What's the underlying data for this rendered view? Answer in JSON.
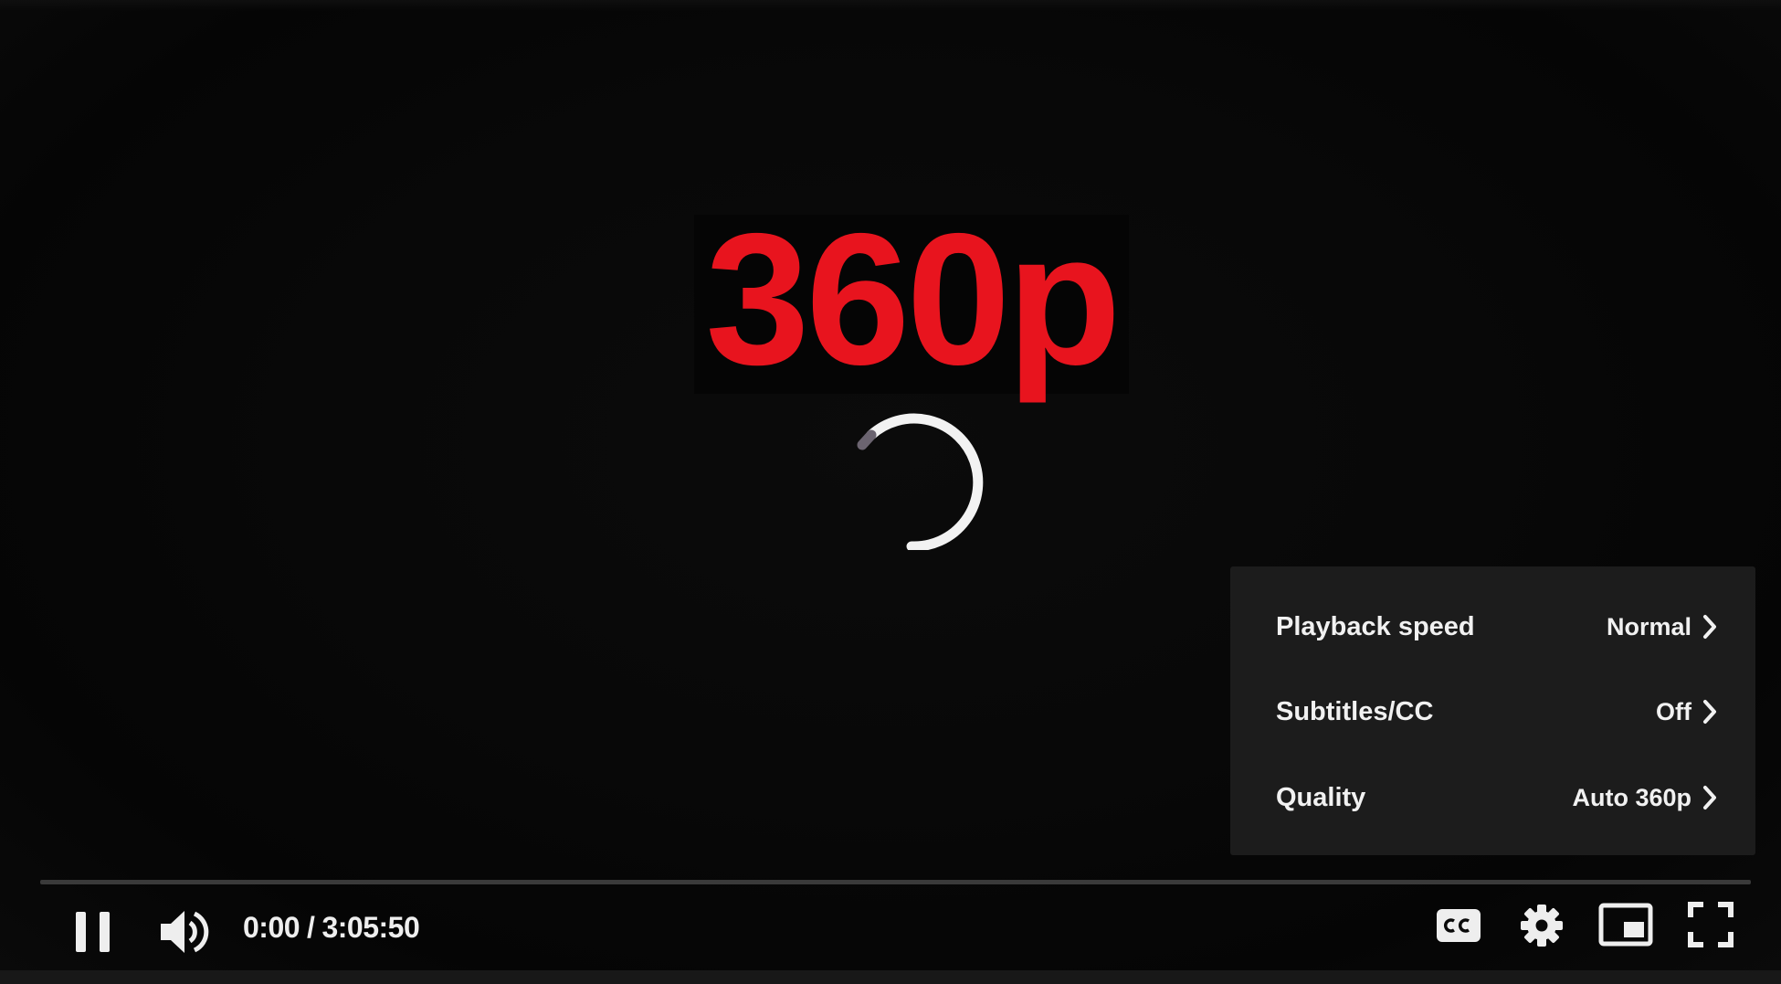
{
  "overlay": {
    "quality_badge": "360p",
    "badge_color": "#e8141e"
  },
  "settings_menu": {
    "items": [
      {
        "label": "Playback speed",
        "value": "Normal",
        "icon": "chevron-right-icon"
      },
      {
        "label": "Subtitles/CC",
        "value": "Off",
        "icon": "chevron-right-icon"
      },
      {
        "label": "Quality",
        "value": "Auto 360p",
        "icon": "chevron-right-icon"
      }
    ]
  },
  "player": {
    "state": "buffering",
    "progress": 0,
    "current_time": "0:00",
    "separator": "/",
    "duration": "3:05:50"
  },
  "controls": {
    "left": [
      "pause-icon",
      "volume-icon"
    ],
    "right": [
      "subtitles-cc-icon",
      "settings-gear-icon",
      "miniplayer-icon",
      "fullscreen-icon"
    ]
  }
}
